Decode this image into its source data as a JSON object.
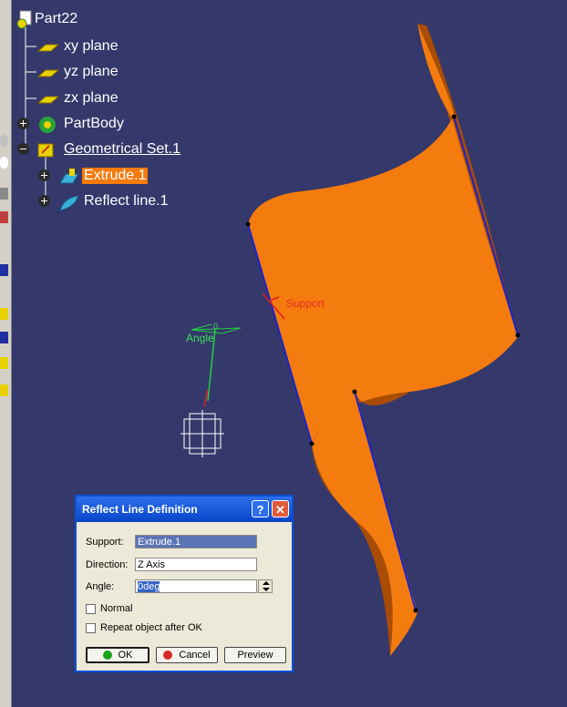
{
  "tree": {
    "root": "Part22",
    "items": [
      {
        "label": "xy plane"
      },
      {
        "label": "yz plane"
      },
      {
        "label": "zx plane"
      },
      {
        "label": "PartBody"
      },
      {
        "label": "Geometrical Set.1"
      },
      {
        "label": "Extrude.1"
      },
      {
        "label": "Reflect line.1"
      }
    ]
  },
  "viewport": {
    "support_label": "Support",
    "angle_label": "Angle",
    "angle_value": "0"
  },
  "dialog": {
    "title": "Reflect Line Definition",
    "help": "?",
    "close": "✕",
    "support_label": "Support:",
    "support_value": "Extrude.1",
    "direction_label": "Direction:",
    "direction_value": "Z Axis",
    "angle_label": "Angle:",
    "angle_value": "0deg",
    "normal_label": "Normal",
    "repeat_label": "Repeat object after OK",
    "ok": "OK",
    "cancel": "Cancel",
    "preview": "Preview"
  },
  "colors": {
    "background": "#35386a",
    "surface": "#f47b0e",
    "surface_dark": "#a84c06",
    "reflect_line": "#1c23c8",
    "selection": "#f47b0e"
  }
}
